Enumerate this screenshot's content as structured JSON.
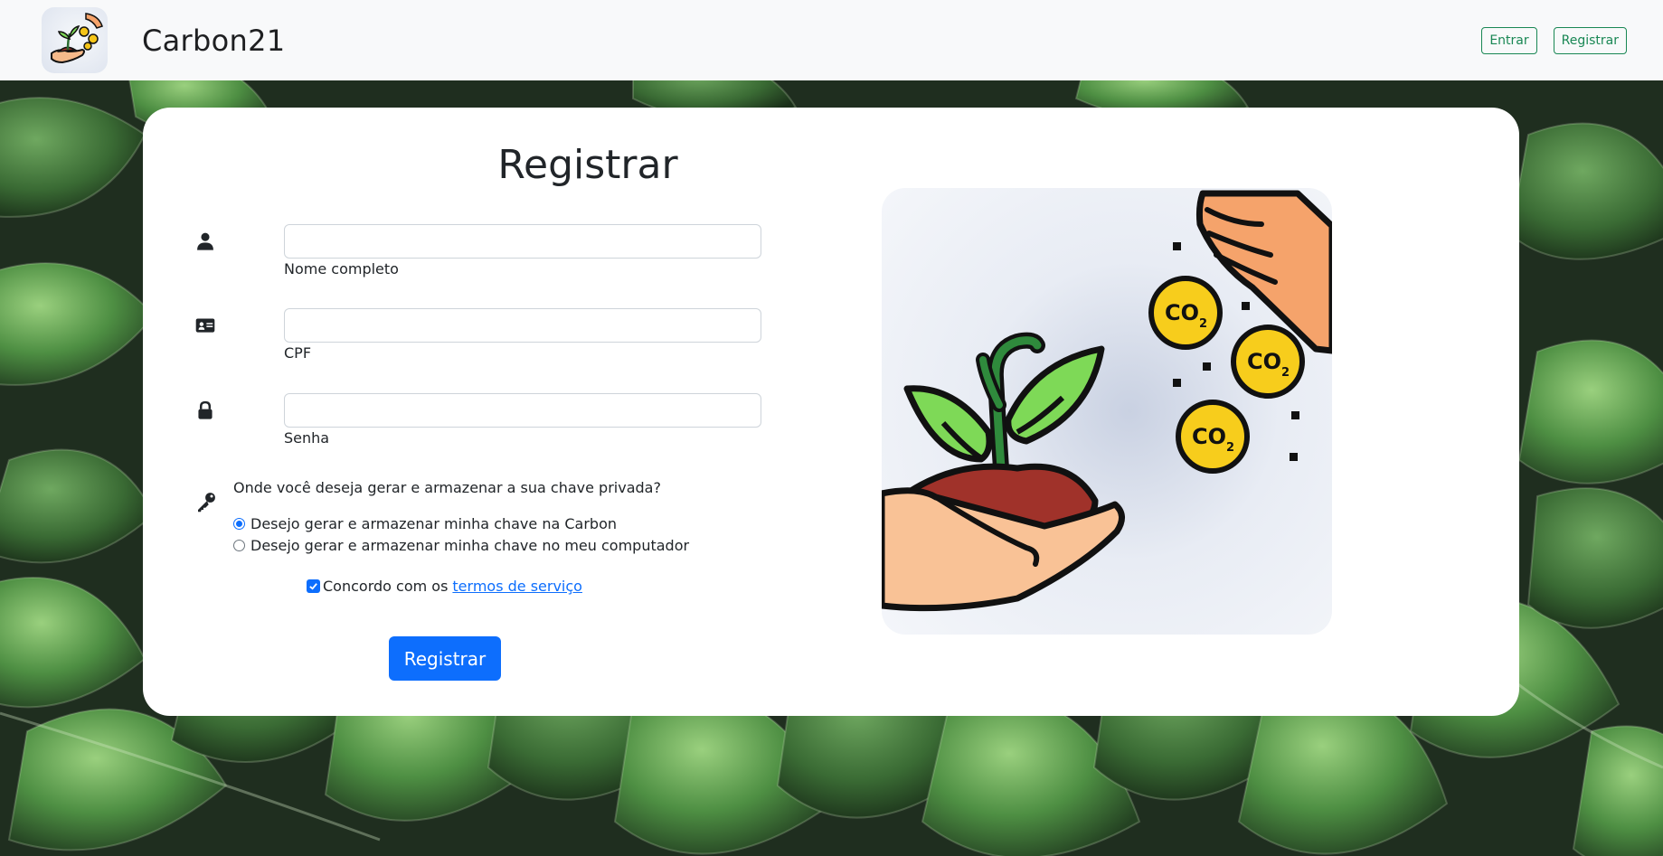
{
  "navbar": {
    "brand": "Carbon21",
    "login_label": "Entrar",
    "register_label": "Registrar"
  },
  "form": {
    "title": "Registrar",
    "name_label": "Nome completo",
    "cpf_label": "CPF",
    "password_label": "Senha",
    "name_value": "",
    "cpf_value": "",
    "password_value": "",
    "key_question": "Onde você deseja gerar e armazenar a sua chave privada?",
    "key_options": [
      "Desejo gerar e armazenar minha chave na Carbon",
      "Desejo gerar e armazenar minha chave no meu computador"
    ],
    "key_selected": 0,
    "terms_prefix": "Concordo com os",
    "terms_link": "termos de serviço",
    "terms_checked": true,
    "submit_label": "Registrar"
  },
  "illustration": {
    "coin_text": "CO",
    "coin_subscript": "2"
  },
  "colors": {
    "primary": "#0d6efd",
    "success": "#198754",
    "navbar_bg": "#f8f9fa",
    "leaf_bg": "#2f4a2e"
  },
  "icons": [
    "user-icon",
    "id-card-icon",
    "lock-icon",
    "key-icon",
    "check-icon"
  ]
}
